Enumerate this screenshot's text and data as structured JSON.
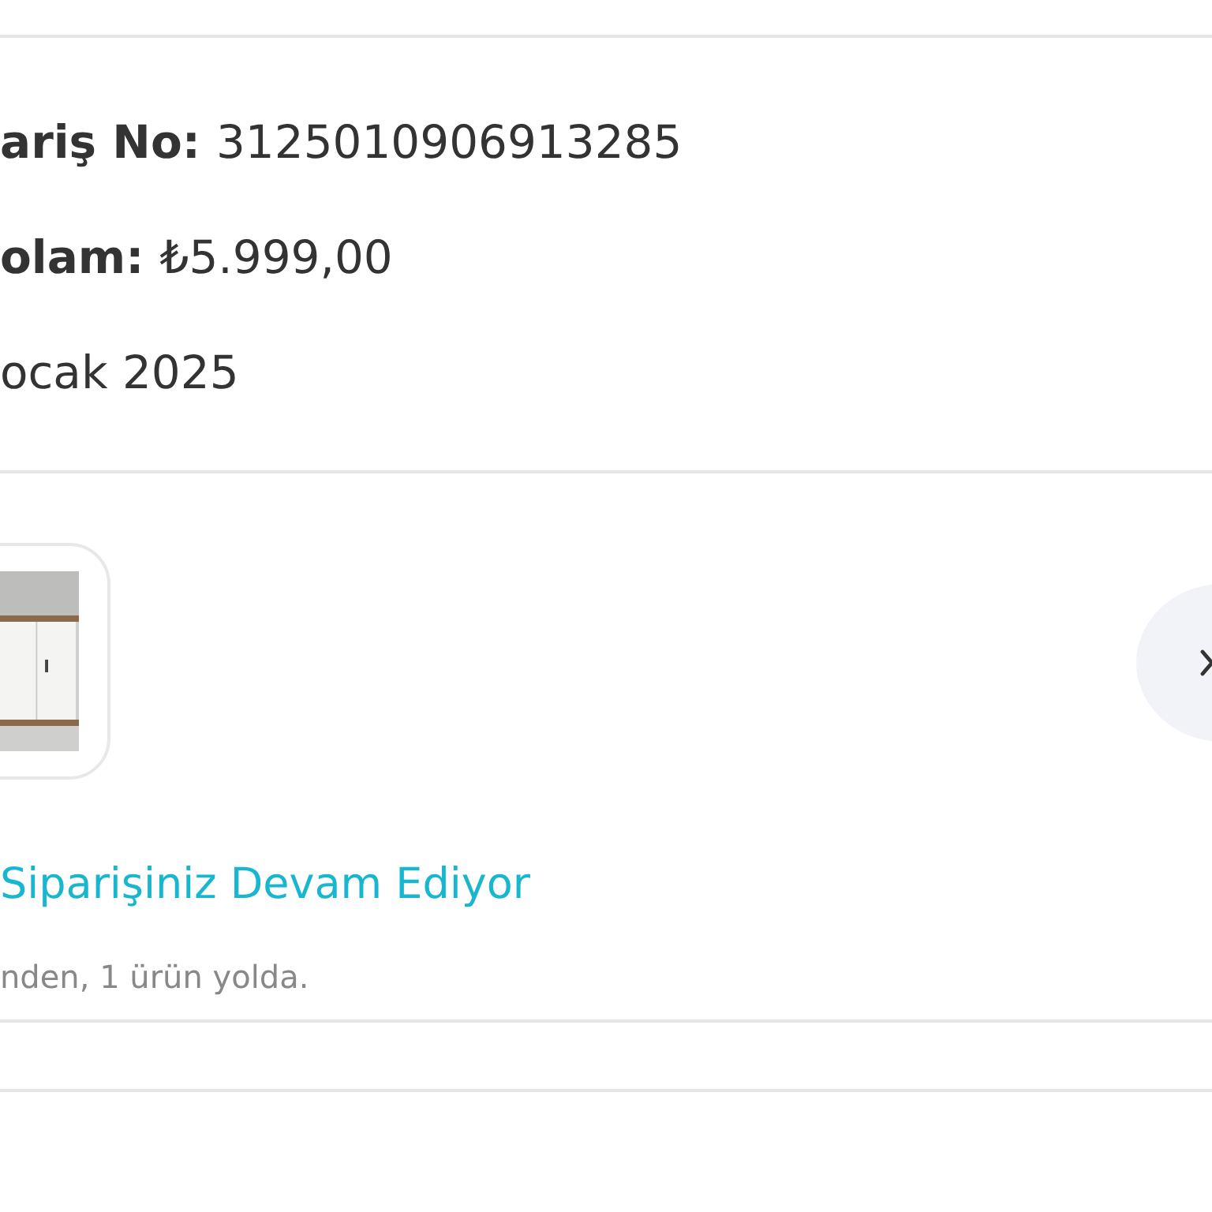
{
  "order_info": [
    {
      "label": "ariş No:",
      "value": "3125010906913285"
    },
    {
      "label": "olam:",
      "value": "₺5.999,00"
    },
    {
      "value": "ocak 2025"
    }
  ],
  "shipment": {
    "status": "Siparişiniz Devam Ediyor",
    "note": "nden, 1 ürün yolda."
  }
}
